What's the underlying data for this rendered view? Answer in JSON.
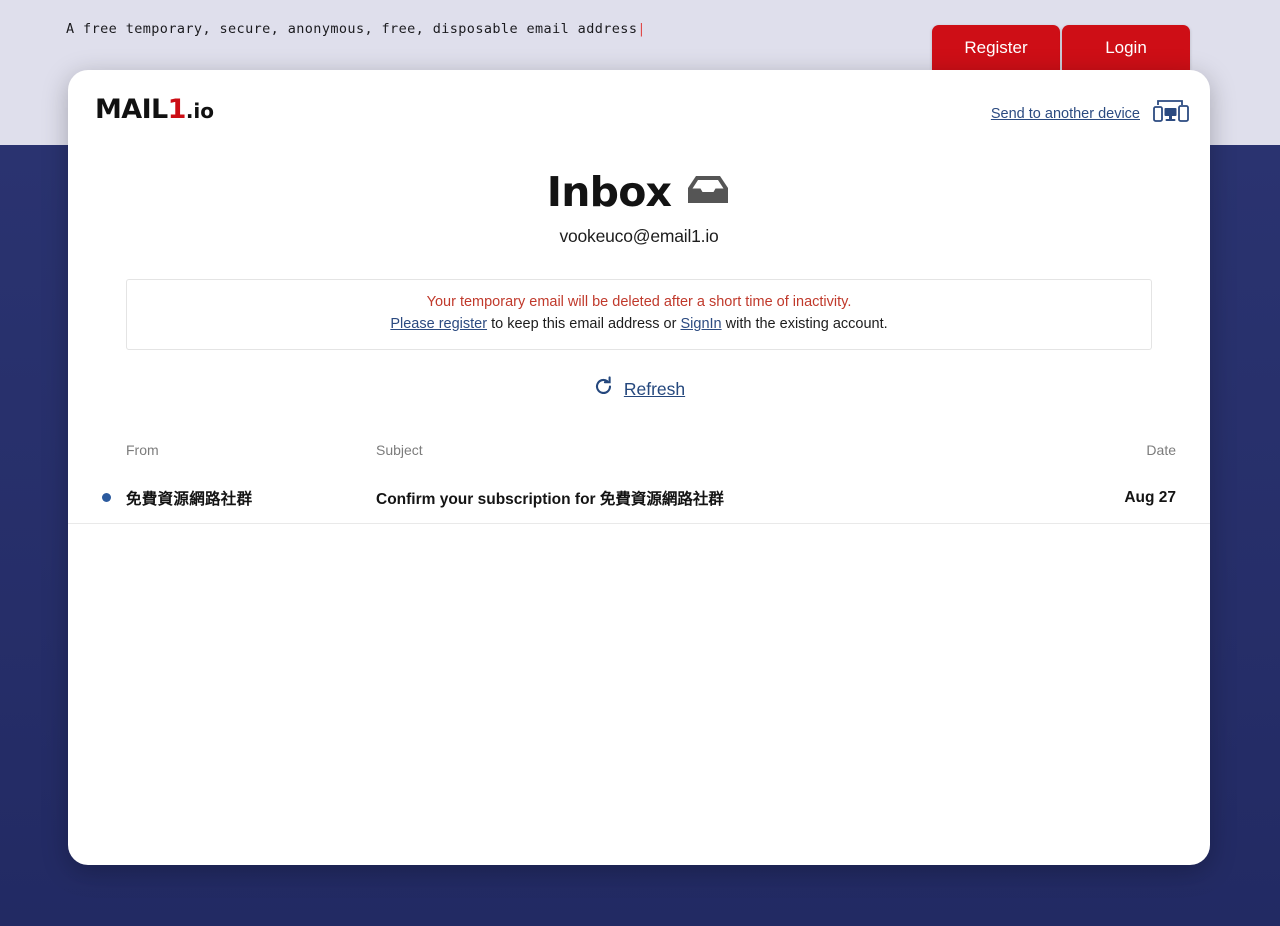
{
  "background": {
    "top_band_color": "#dfdfec",
    "bottom_color": "#272f6b"
  },
  "tagline": {
    "text": "A free temporary, secure, anonymous, free, disposable email address",
    "caret": "|",
    "caret_color": "#e04a4a"
  },
  "auth": {
    "register_label": "Register",
    "login_label": "Login",
    "button_color": "#ce0e16"
  },
  "brand": {
    "name_part1": "MAIL",
    "name_accent": "1",
    "name_tld": ".io",
    "accent_color": "#cc0d14"
  },
  "header": {
    "send_to_device_label": "Send to another device",
    "send_to_device_icon": "devices-icon",
    "link_color": "#2b4a80"
  },
  "inbox": {
    "title": "Inbox",
    "title_icon": "inbox-tray-icon",
    "email_address": "vookeuco@email1.io"
  },
  "notice": {
    "warning_text": "Your temporary email will be deleted after a short time of inactivity.",
    "warning_color": "#c0392b",
    "register_link": "Please register",
    "middle_text": " to keep this email address or ",
    "signin_link": "SignIn",
    "tail_text": "  with the existing account."
  },
  "refresh": {
    "label": "Refresh",
    "icon": "refresh-circular-arrow-icon",
    "color": "#24477d"
  },
  "mail_table": {
    "columns": {
      "from": "From",
      "subject": "Subject",
      "date": "Date"
    },
    "rows": [
      {
        "unread": true,
        "from": "免費資源網路社群",
        "subject": "Confirm your subscription for 免費資源網路社群",
        "date": "Aug 27",
        "unread_dot_color": "#2b5a9e"
      }
    ]
  }
}
